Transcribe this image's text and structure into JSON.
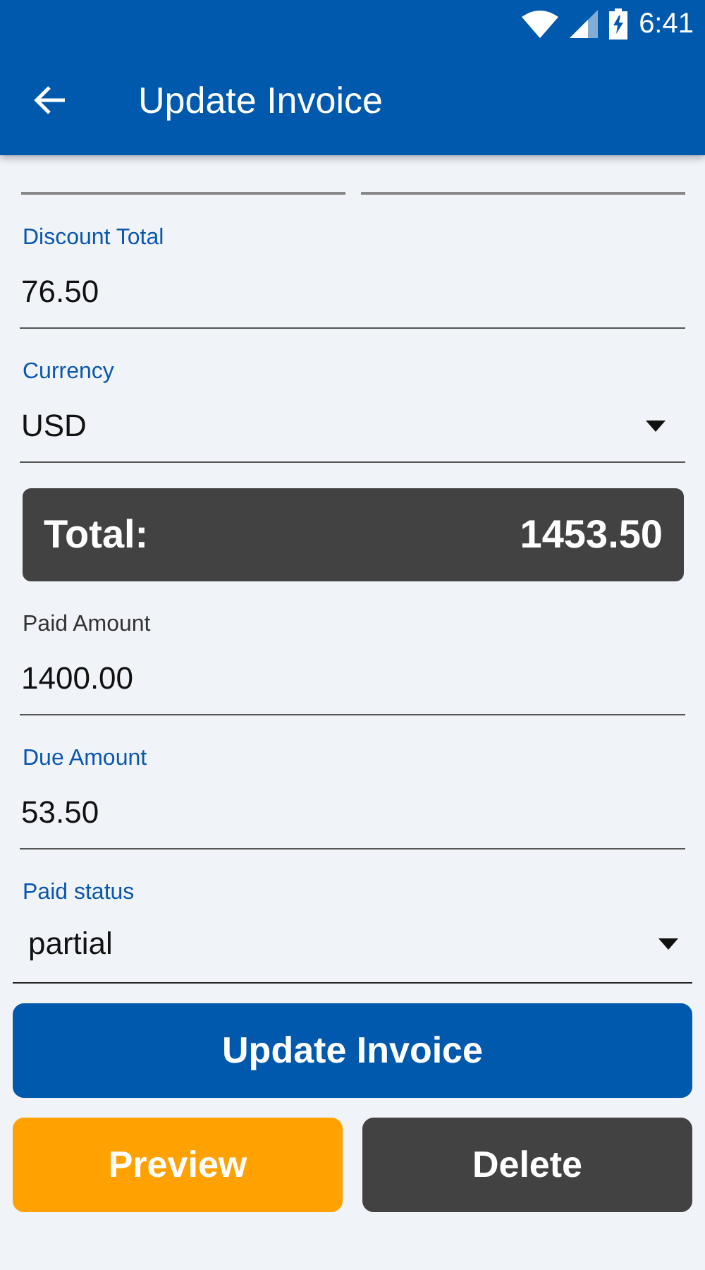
{
  "status_bar": {
    "time": "6:41"
  },
  "app_bar": {
    "title": "Update Invoice"
  },
  "fields": [
    {
      "kind": "text",
      "label": "Discount Total",
      "value": "76.50",
      "accent_label": true
    },
    {
      "kind": "dropdown",
      "label": "Currency",
      "value": "USD",
      "accent_label": true
    },
    {
      "kind": "total",
      "label": "Total:",
      "value": "1453.50"
    },
    {
      "kind": "text",
      "label": "Paid Amount",
      "value": "1400.00",
      "accent_label": false
    },
    {
      "kind": "text",
      "label": "Due Amount",
      "value": "53.50",
      "accent_label": true
    },
    {
      "kind": "status",
      "label": "Paid status",
      "value": "partial",
      "accent_label": true
    }
  ],
  "buttons": [
    {
      "kind": "primary",
      "label": "Update Invoice"
    },
    {
      "kind": "preview",
      "label": "Preview"
    },
    {
      "kind": "delete",
      "label": "Delete"
    }
  ]
}
